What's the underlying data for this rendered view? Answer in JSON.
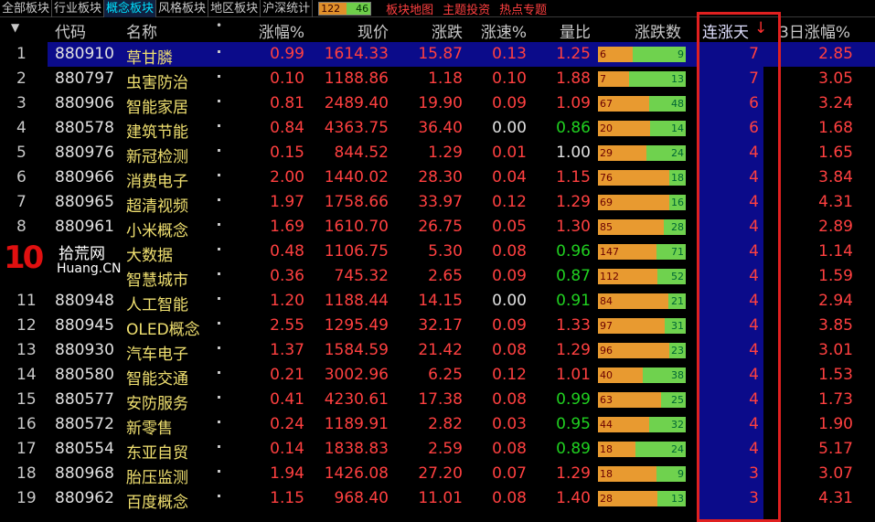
{
  "tabs": [
    {
      "label": "全部板块",
      "active": false
    },
    {
      "label": "行业板块",
      "active": false
    },
    {
      "label": "概念板块",
      "active": true
    },
    {
      "label": "风格板块",
      "active": false
    },
    {
      "label": "地区板块",
      "active": false
    },
    {
      "label": "沪深统计",
      "active": false
    }
  ],
  "counter": {
    "up": "122",
    "down": "46"
  },
  "links": {
    "map": "板块地图",
    "theme": "主题投资",
    "hot": "热点专题"
  },
  "header": {
    "code": "代码",
    "name": "名称",
    "dot": "•",
    "pct": "涨幅%",
    "price": "现价",
    "chg": "涨跌",
    "speed": "涨速%",
    "ratio": "量比",
    "updown": "涨跌数",
    "days": "连涨天",
    "days_arrow": "↓",
    "pct3d": "3日涨幅%"
  },
  "watermark": {
    "logo": "10",
    "cn": "拾荒网",
    "en": "Huang.CN"
  },
  "rows": [
    {
      "idx": "1",
      "code": "880910",
      "name": "草甘膦",
      "pct": "0.99",
      "price": "1614.33",
      "chg": "15.87",
      "speed": "0.13",
      "speed_color": "red",
      "ratio": "1.25",
      "ratio_color": "red",
      "up": "6",
      "down": "9",
      "up_frac": 0.4,
      "days": "7",
      "pct3d": "2.85",
      "selected": true
    },
    {
      "idx": "2",
      "code": "880797",
      "name": "虫害防治",
      "pct": "0.10",
      "price": "1188.86",
      "chg": "1.18",
      "speed": "0.10",
      "speed_color": "red",
      "ratio": "1.88",
      "ratio_color": "red",
      "up": "7",
      "down": "13",
      "up_frac": 0.35,
      "days": "7",
      "pct3d": "3.05",
      "selected": false
    },
    {
      "idx": "3",
      "code": "880906",
      "name": "智能家居",
      "pct": "0.81",
      "price": "2489.40",
      "chg": "19.90",
      "speed": "0.09",
      "speed_color": "red",
      "ratio": "1.09",
      "ratio_color": "red",
      "up": "67",
      "down": "48",
      "up_frac": 0.58,
      "days": "6",
      "pct3d": "3.24",
      "selected": false
    },
    {
      "idx": "4",
      "code": "880578",
      "name": "建筑节能",
      "pct": "0.84",
      "price": "4363.75",
      "chg": "36.40",
      "speed": "0.00",
      "speed_color": "white",
      "ratio": "0.86",
      "ratio_color": "green",
      "up": "20",
      "down": "14",
      "up_frac": 0.59,
      "days": "6",
      "pct3d": "1.68",
      "selected": false
    },
    {
      "idx": "5",
      "code": "880976",
      "name": "新冠检测",
      "pct": "0.15",
      "price": "844.52",
      "chg": "1.29",
      "speed": "0.01",
      "speed_color": "red",
      "ratio": "1.00",
      "ratio_color": "white",
      "up": "29",
      "down": "24",
      "up_frac": 0.55,
      "days": "4",
      "pct3d": "1.65",
      "selected": false
    },
    {
      "idx": "6",
      "code": "880966",
      "name": "消费电子",
      "pct": "2.00",
      "price": "1440.02",
      "chg": "28.30",
      "speed": "0.04",
      "speed_color": "red",
      "ratio": "1.15",
      "ratio_color": "red",
      "up": "76",
      "down": "18",
      "up_frac": 0.81,
      "days": "4",
      "pct3d": "3.84",
      "selected": false
    },
    {
      "idx": "7",
      "code": "880965",
      "name": "超清视频",
      "pct": "1.97",
      "price": "1758.66",
      "chg": "33.97",
      "speed": "0.12",
      "speed_color": "red",
      "ratio": "1.29",
      "ratio_color": "red",
      "up": "69",
      "down": "16",
      "up_frac": 0.81,
      "days": "4",
      "pct3d": "4.31",
      "selected": false
    },
    {
      "idx": "8",
      "code": "880961",
      "name": "小米概念",
      "pct": "1.69",
      "price": "1610.70",
      "chg": "26.75",
      "speed": "0.05",
      "speed_color": "red",
      "ratio": "1.30",
      "ratio_color": "red",
      "up": "85",
      "down": "28",
      "up_frac": 0.75,
      "days": "4",
      "pct3d": "2.89",
      "selected": false
    },
    {
      "idx": "",
      "code": "",
      "name": "大数据",
      "pct": "0.48",
      "price": "1106.75",
      "chg": "5.30",
      "speed": "0.08",
      "speed_color": "red",
      "ratio": "0.96",
      "ratio_color": "green",
      "up": "147",
      "down": "71",
      "up_frac": 0.67,
      "days": "4",
      "pct3d": "1.14",
      "selected": false
    },
    {
      "idx": "",
      "code": "",
      "name": "智慧城市",
      "pct": "0.36",
      "price": "745.32",
      "chg": "2.65",
      "speed": "0.09",
      "speed_color": "red",
      "ratio": "0.87",
      "ratio_color": "green",
      "up": "112",
      "down": "52",
      "up_frac": 0.68,
      "days": "4",
      "pct3d": "1.59",
      "selected": false
    },
    {
      "idx": "11",
      "code": "880948",
      "name": "人工智能",
      "pct": "1.20",
      "price": "1188.44",
      "chg": "14.15",
      "speed": "0.00",
      "speed_color": "white",
      "ratio": "0.91",
      "ratio_color": "green",
      "up": "84",
      "down": "21",
      "up_frac": 0.8,
      "days": "4",
      "pct3d": "2.94",
      "selected": false
    },
    {
      "idx": "12",
      "code": "880945",
      "name": "OLED概念",
      "pct": "2.55",
      "price": "1295.49",
      "chg": "32.17",
      "speed": "0.09",
      "speed_color": "red",
      "ratio": "1.33",
      "ratio_color": "red",
      "up": "97",
      "down": "31",
      "up_frac": 0.76,
      "days": "4",
      "pct3d": "3.85",
      "selected": false
    },
    {
      "idx": "13",
      "code": "880930",
      "name": "汽车电子",
      "pct": "1.37",
      "price": "1584.59",
      "chg": "21.42",
      "speed": "0.08",
      "speed_color": "red",
      "ratio": "1.29",
      "ratio_color": "red",
      "up": "96",
      "down": "23",
      "up_frac": 0.81,
      "days": "4",
      "pct3d": "3.01",
      "selected": false
    },
    {
      "idx": "14",
      "code": "880580",
      "name": "智能交通",
      "pct": "0.21",
      "price": "3002.96",
      "chg": "6.25",
      "speed": "0.12",
      "speed_color": "red",
      "ratio": "1.01",
      "ratio_color": "red",
      "up": "40",
      "down": "38",
      "up_frac": 0.51,
      "days": "4",
      "pct3d": "1.53",
      "selected": false
    },
    {
      "idx": "15",
      "code": "880577",
      "name": "安防服务",
      "pct": "0.41",
      "price": "4230.61",
      "chg": "17.38",
      "speed": "0.08",
      "speed_color": "red",
      "ratio": "0.99",
      "ratio_color": "green",
      "up": "63",
      "down": "25",
      "up_frac": 0.72,
      "days": "4",
      "pct3d": "1.73",
      "selected": false
    },
    {
      "idx": "16",
      "code": "880572",
      "name": "新零售",
      "pct": "0.24",
      "price": "1189.91",
      "chg": "2.82",
      "speed": "0.03",
      "speed_color": "red",
      "ratio": "0.95",
      "ratio_color": "green",
      "up": "44",
      "down": "32",
      "up_frac": 0.58,
      "days": "4",
      "pct3d": "1.90",
      "selected": false
    },
    {
      "idx": "17",
      "code": "880554",
      "name": "东亚自贸",
      "pct": "0.14",
      "price": "1838.83",
      "chg": "2.59",
      "speed": "0.08",
      "speed_color": "red",
      "ratio": "0.89",
      "ratio_color": "green",
      "up": "18",
      "down": "24",
      "up_frac": 0.43,
      "days": "4",
      "pct3d": "5.17",
      "selected": false
    },
    {
      "idx": "18",
      "code": "880968",
      "name": "胎压监测",
      "pct": "1.94",
      "price": "1426.08",
      "chg": "27.20",
      "speed": "0.07",
      "speed_color": "red",
      "ratio": "1.29",
      "ratio_color": "red",
      "up": "18",
      "down": "9",
      "up_frac": 0.67,
      "days": "3",
      "pct3d": "3.07",
      "selected": false
    },
    {
      "idx": "19",
      "code": "880962",
      "name": "百度概念",
      "pct": "1.15",
      "price": "968.40",
      "chg": "11.01",
      "speed": "0.08",
      "speed_color": "red",
      "ratio": "1.40",
      "ratio_color": "red",
      "up": "28",
      "down": "13",
      "up_frac": 0.68,
      "days": "3",
      "pct3d": "4.31",
      "selected": false
    }
  ]
}
